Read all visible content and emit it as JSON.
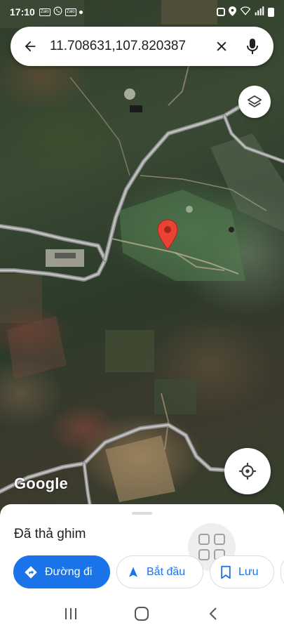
{
  "status_bar": {
    "time": "17:10",
    "app_icons": [
      "Zalo",
      "Zalo"
    ],
    "left_icons": [
      "zalo-icon",
      "phone-icon",
      "zalo-icon",
      "dot-icon"
    ],
    "right_icons": [
      "lock-icon",
      "location-icon",
      "wifi-icon",
      "signal-icon",
      "battery-icon"
    ]
  },
  "search": {
    "query": "11.708631,107.820387",
    "back_icon": "arrow-back-icon",
    "clear_icon": "close-icon",
    "mic_icon": "mic-icon"
  },
  "map": {
    "layers_icon": "layers-icon",
    "pin_color": "#ea4335",
    "locate_icon": "my-location-icon",
    "logo": "Google"
  },
  "sheet": {
    "title": "Đã thả ghim",
    "actions": {
      "directions": "Đường đi",
      "start": "Bắt đầu",
      "save": "Lưu"
    }
  },
  "colors": {
    "accent": "#1a73e8",
    "pin": "#ea4335"
  }
}
